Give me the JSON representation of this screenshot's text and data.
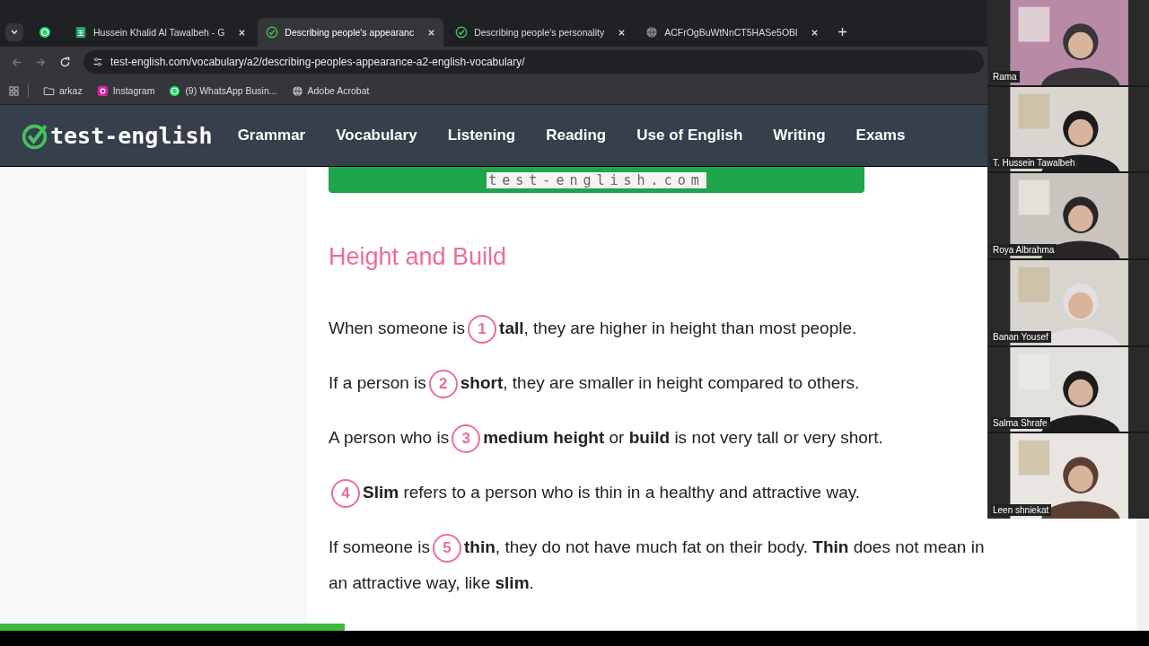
{
  "tabs": [
    {
      "kind": "pinned",
      "selected": false
    },
    {
      "kind": "sheet",
      "title": "Hussein Khalid Al Tawalbeh - G",
      "selected": false
    },
    {
      "kind": "check",
      "title": "Describing people's appearanc",
      "selected": true
    },
    {
      "kind": "check",
      "title": "Describing people's personality",
      "selected": false
    },
    {
      "kind": "globe",
      "title": "ACFrOgBuWtNnCT5HASe5OBl",
      "selected": false
    }
  ],
  "address": "test-english.com/vocabulary/a2/describing-peoples-appearance-a2-english-vocabulary/",
  "bookmarks": [
    {
      "kind": "folder",
      "label": "arkaz"
    },
    {
      "kind": "instagram",
      "label": "Instagram"
    },
    {
      "kind": "whatsapp",
      "label": "(9) WhatsApp Busin..."
    },
    {
      "kind": "globe",
      "label": "Adobe Acrobat"
    }
  ],
  "site": {
    "logo": "test-english",
    "nav": [
      "Grammar",
      "Vocabulary",
      "Listening",
      "Reading",
      "Use of English",
      "Writing",
      "Exams"
    ]
  },
  "banner": "test-english.com",
  "heading": "Height and Build",
  "sentences": [
    {
      "before": "When someone is",
      "number": "1",
      "after": "**tall**, they are higher in height than most people."
    },
    {
      "before": "If a person is",
      "number": "2",
      "after": "**short**, they are smaller in height compared to others."
    },
    {
      "before": "A person who is",
      "number": "3",
      "after": "**medium height** or **build** is not very tall or very short."
    },
    {
      "number": "4",
      "after": "**Slim** refers to a person who is thin in a healthy and attractive way."
    },
    {
      "before": "If someone is",
      "number": "5",
      "after": "**thin**, they do not have much fat on their body. **Thin** does not mean in",
      "more": "an attractive way, like **slim**."
    }
  ],
  "progress": {
    "level": 0.3
  },
  "participants": [
    {
      "name": "Rama"
    },
    {
      "name": "T. Hussein Tawalbeh"
    },
    {
      "name": "Roya Albrahma"
    },
    {
      "name": "Banan Yousef"
    },
    {
      "name": "Salma Shrafe"
    },
    {
      "name": "Leen shniekat"
    }
  ]
}
